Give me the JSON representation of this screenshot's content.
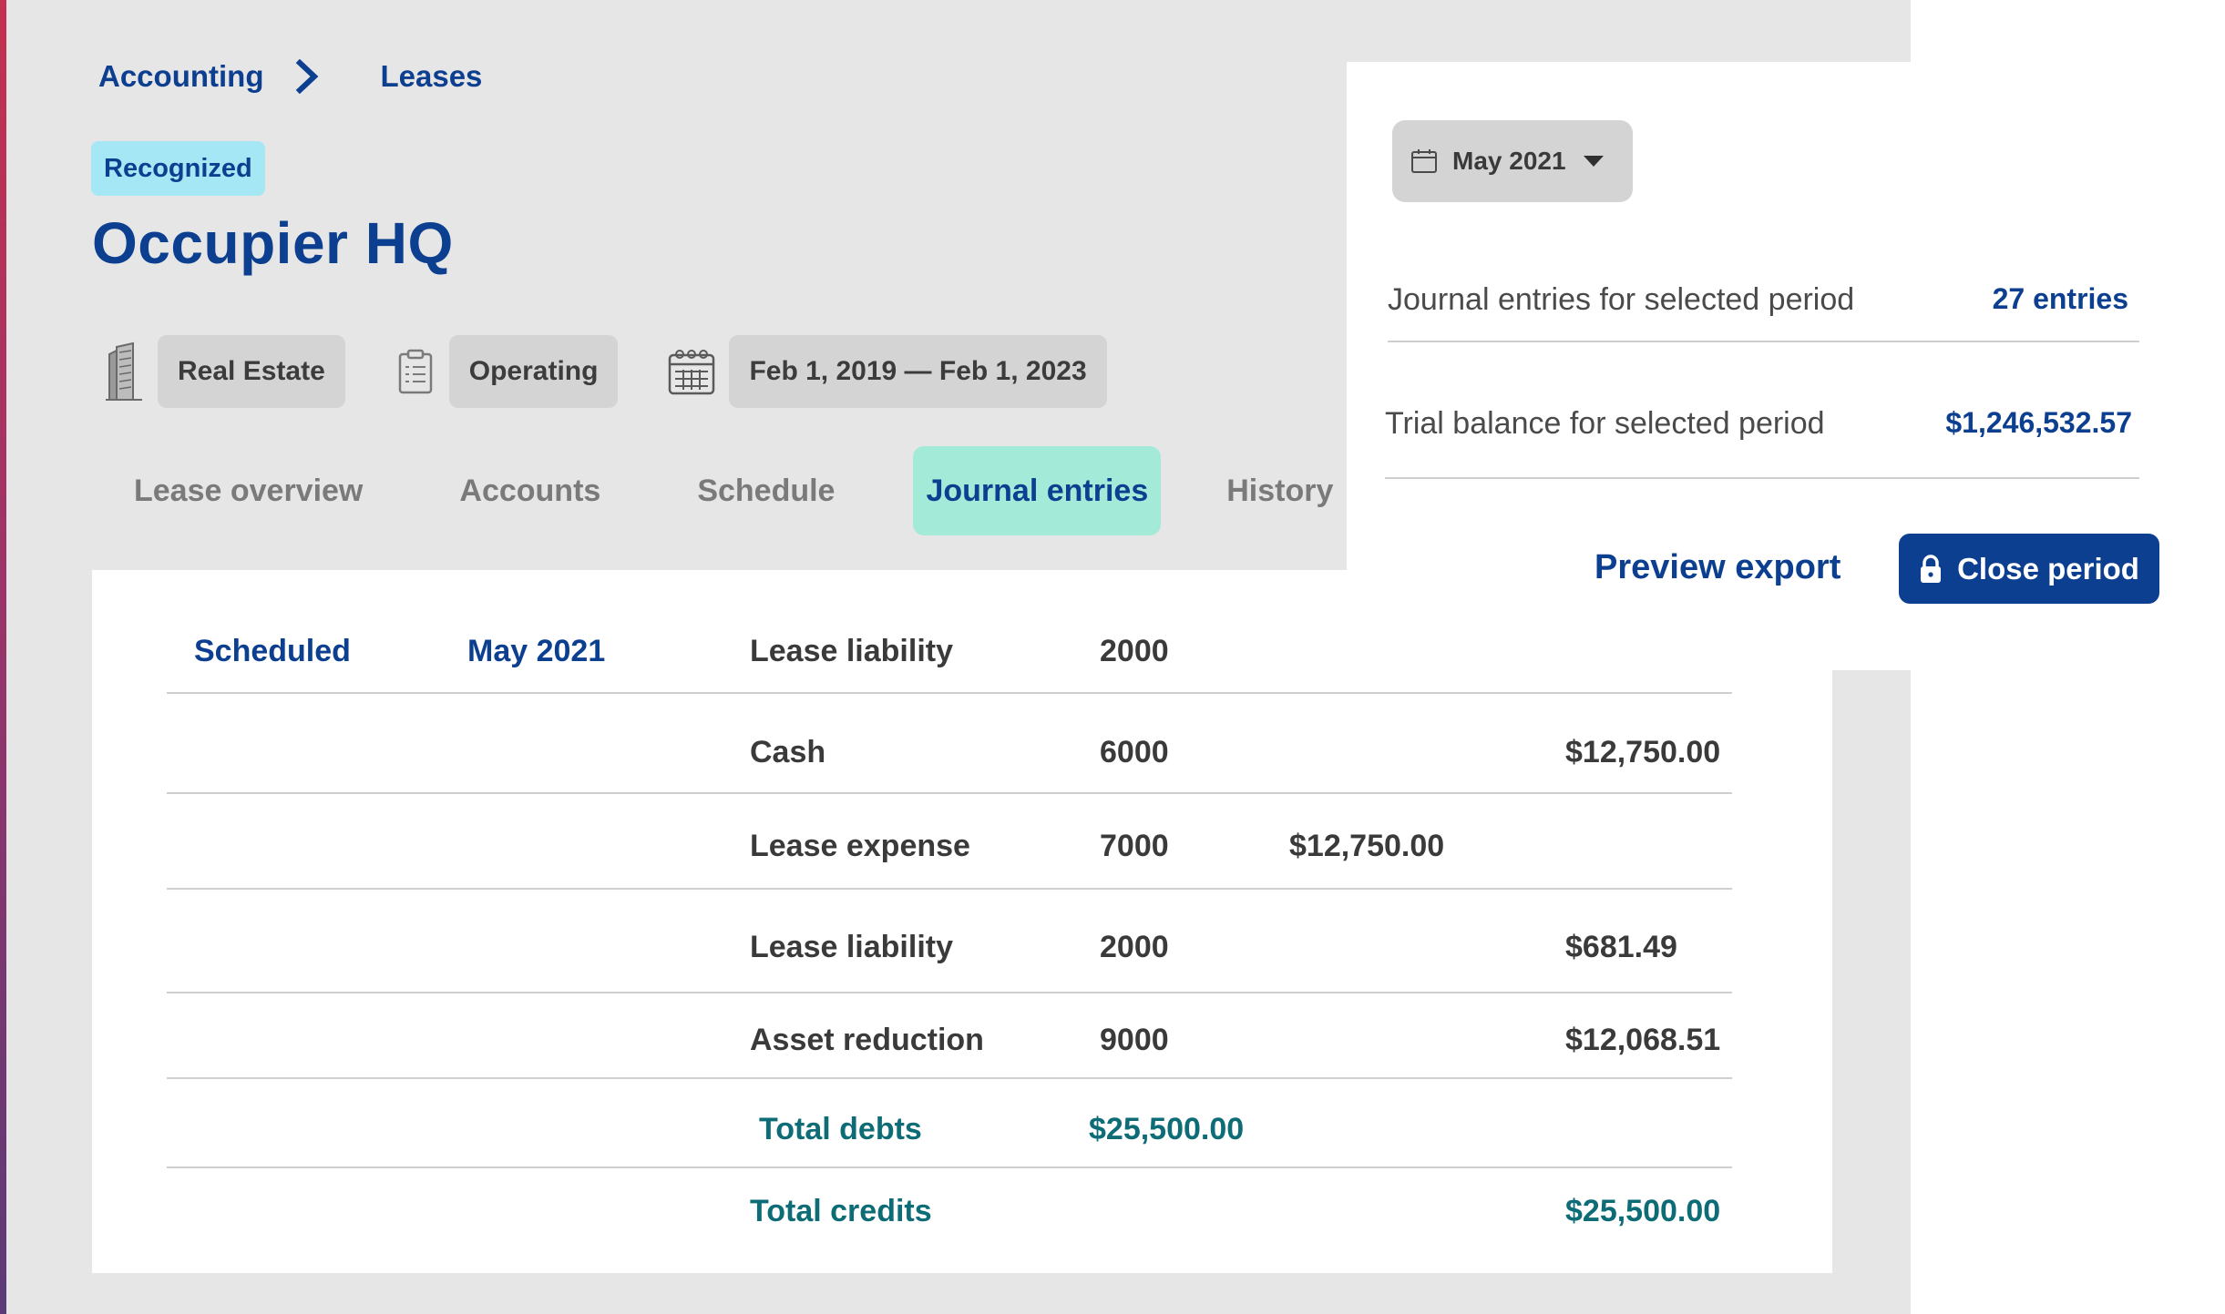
{
  "breadcrumb": {
    "items": [
      "Accounting",
      "Leases"
    ]
  },
  "status_badge": "Recognized",
  "title": "Occupier HQ",
  "meta": {
    "property_type": "Real Estate",
    "lease_type": "Operating",
    "date_range": "Feb 1, 2019 — Feb 1, 2023"
  },
  "tabs": [
    {
      "label": "Lease overview"
    },
    {
      "label": "Accounts"
    },
    {
      "label": "Schedule"
    },
    {
      "label": "Journal entries",
      "active": true
    },
    {
      "label": "History"
    }
  ],
  "period": {
    "selected": "May 2021",
    "journal_entries_label": "Journal entries for selected period",
    "journal_entries_value": "27 entries",
    "trial_balance_label": "Trial balance for selected period",
    "trial_balance_value": "$1,246,532.57"
  },
  "actions": {
    "preview_export": "Preview export",
    "close_period": "Close period"
  },
  "entries": {
    "status": "Scheduled",
    "period": "May 2021",
    "rows": [
      {
        "account": "Lease liability",
        "code": "2000",
        "debit": "",
        "credit": ""
      },
      {
        "account": "Cash",
        "code": "6000",
        "debit": "",
        "credit": "$12,750.00"
      },
      {
        "account": "Lease expense",
        "code": "7000",
        "debit": "$12,750.00",
        "credit": ""
      },
      {
        "account": "Lease liability",
        "code": "2000",
        "debit": "",
        "credit": "$681.49"
      },
      {
        "account": "Asset reduction",
        "code": "9000",
        "debit": "",
        "credit": "$12,068.51"
      }
    ],
    "total_debits_label": "Total debts",
    "total_debits_value": "$25,500.00",
    "total_credits_label": "Total credits",
    "total_credits_value": "$25,500.00"
  },
  "colors": {
    "primary": "#0c3f8f",
    "teal": "#0d6c75",
    "badge": "#a6e7f6",
    "active_tab": "#a4ead8",
    "background": "#e6e6e6"
  },
  "icons": {
    "breadcrumb_separator": "chevron-right-icon",
    "property": "building-icon",
    "lease": "clipboard-icon",
    "dates": "calendar-icon",
    "period": "calendar-icon",
    "dropdown": "caret-down-icon",
    "close": "lock-icon"
  }
}
